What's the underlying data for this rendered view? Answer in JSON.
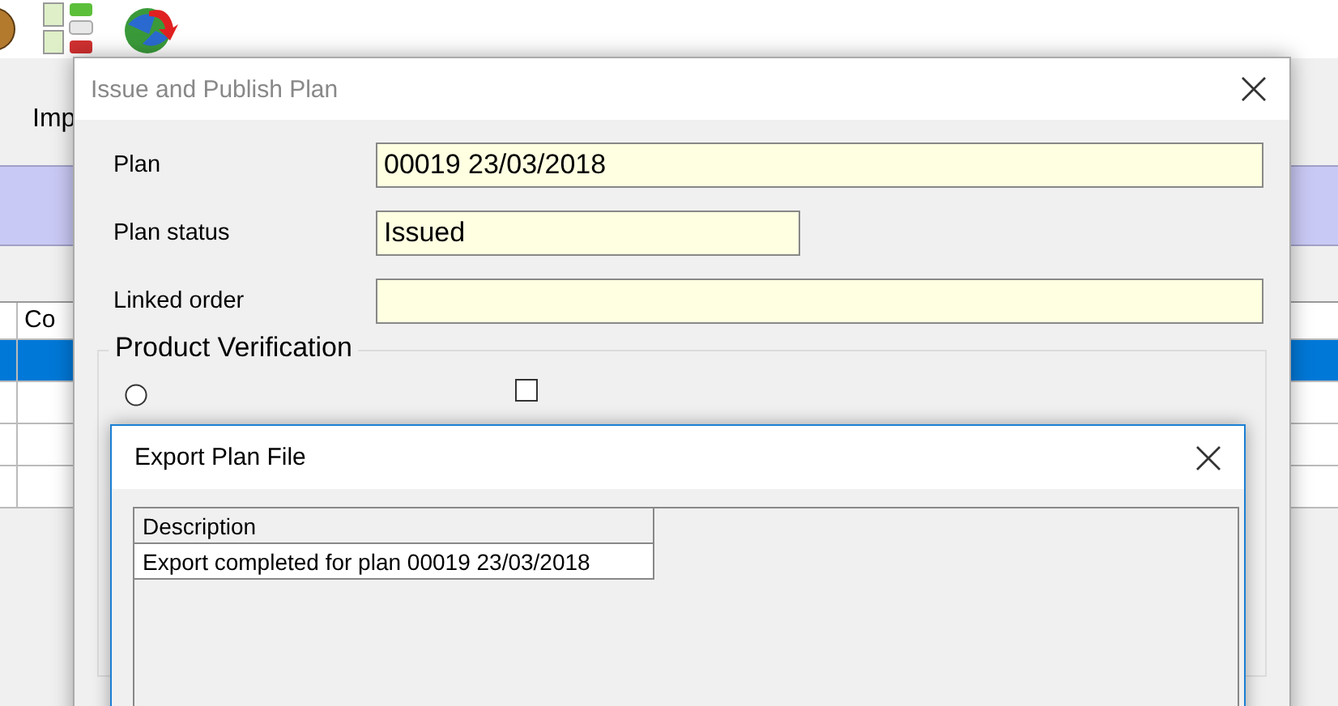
{
  "background_app": {
    "menu_label": "Imp",
    "table": {
      "column_1": "Co",
      "rows": [
        {
          "selected": true
        },
        {
          "selected": false
        },
        {
          "selected": false
        },
        {
          "selected": false
        }
      ]
    }
  },
  "dialog": {
    "title": "Issue and Publish Plan",
    "fields": [
      {
        "label": "Plan",
        "value": "00019 23/03/2018",
        "kind": "wide"
      },
      {
        "label": "Plan status",
        "value": "Issued",
        "kind": "short"
      },
      {
        "label": "Linked order",
        "kind": "wide"
      }
    ],
    "group": {
      "title": "Product Verification",
      "radio": {
        "selected": false
      },
      "checkbox": {
        "checked": false
      }
    }
  },
  "export_dialog": {
    "title": "Export Plan File",
    "columns": [
      "Description"
    ],
    "rows": [
      "Export completed for plan 00019 23/03/2018"
    ]
  }
}
